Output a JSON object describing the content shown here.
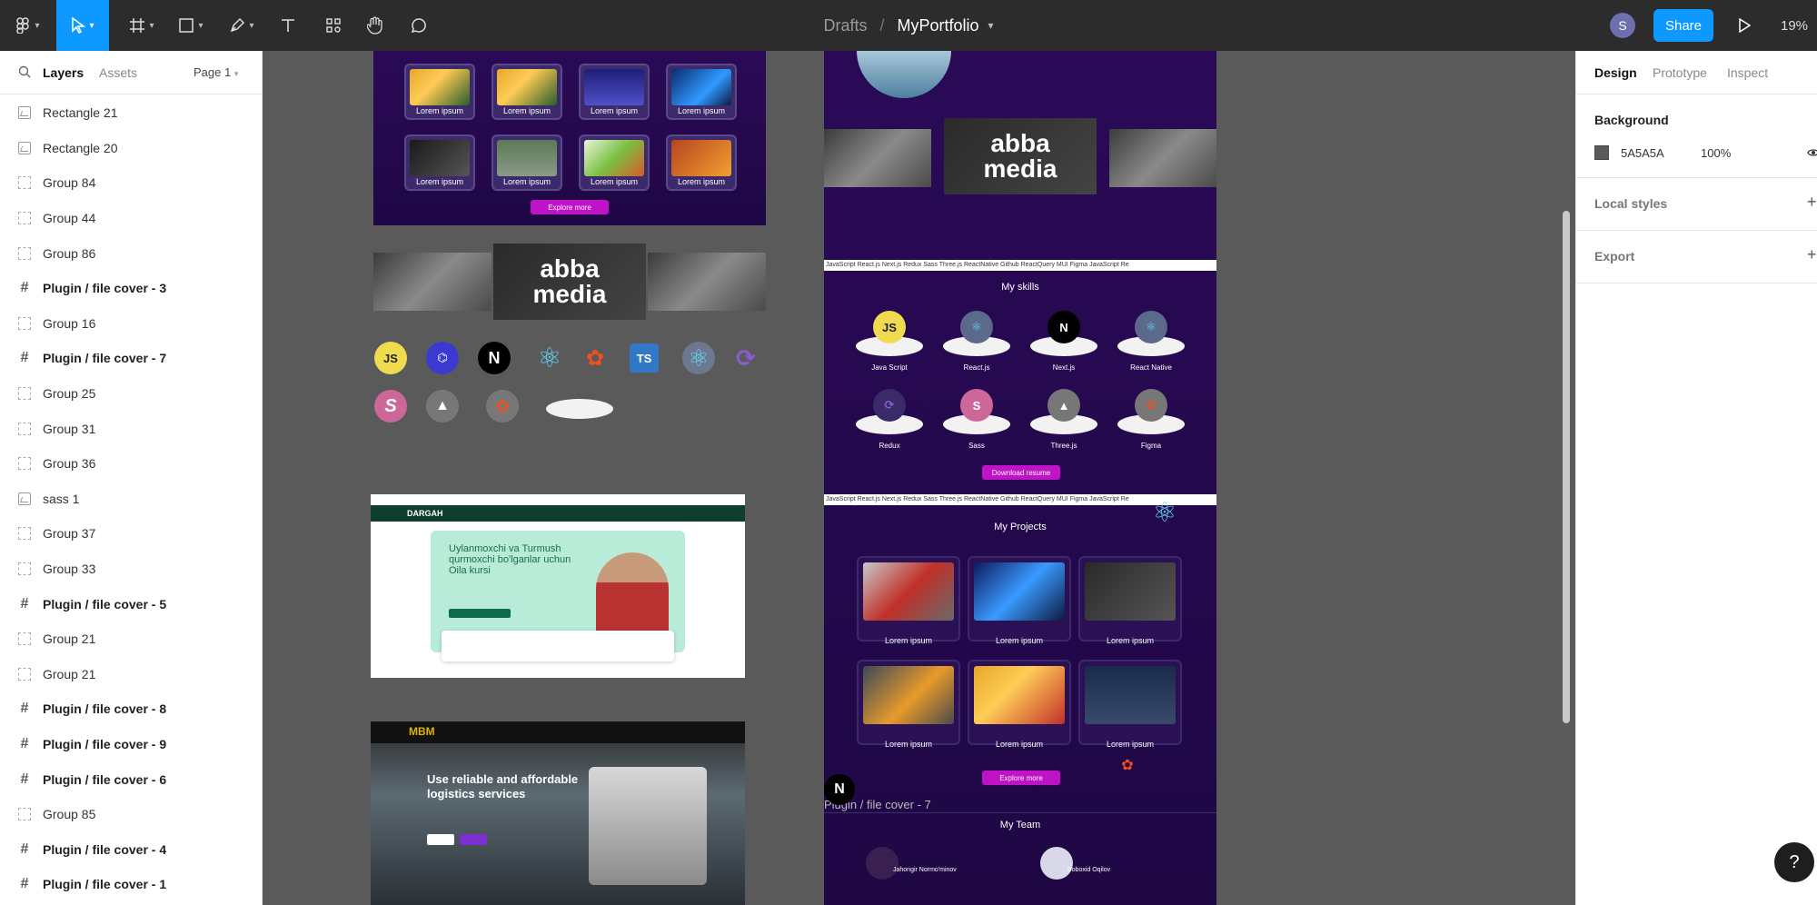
{
  "toolbar": {
    "breadcrumb": "Drafts",
    "separator": "/",
    "file_name": "MyPortfolio",
    "avatar_initial": "S",
    "share_label": "Share",
    "zoom": "19%"
  },
  "left_panel": {
    "tabs": [
      "Layers",
      "Assets"
    ],
    "page_selector": "Page 1",
    "layers": [
      {
        "label": "Rectangle 21",
        "type": "image"
      },
      {
        "label": "Rectangle 20",
        "type": "image"
      },
      {
        "label": "Group 84",
        "type": "group"
      },
      {
        "label": "Group 44",
        "type": "group"
      },
      {
        "label": "Group 86",
        "type": "group"
      },
      {
        "label": "Plugin / file cover - 3",
        "type": "frame"
      },
      {
        "label": "Group 16",
        "type": "group"
      },
      {
        "label": "Plugin / file cover - 7",
        "type": "frame"
      },
      {
        "label": "Group 25",
        "type": "group"
      },
      {
        "label": "Group 31",
        "type": "group"
      },
      {
        "label": "Group 36",
        "type": "group"
      },
      {
        "label": "sass 1",
        "type": "image"
      },
      {
        "label": "Group 37",
        "type": "group"
      },
      {
        "label": "Group 33",
        "type": "group"
      },
      {
        "label": "Plugin / file cover - 5",
        "type": "frame"
      },
      {
        "label": "Group 21",
        "type": "group"
      },
      {
        "label": "Group 21",
        "type": "group"
      },
      {
        "label": "Plugin / file cover - 8",
        "type": "frame"
      },
      {
        "label": "Plugin / file cover - 9",
        "type": "frame"
      },
      {
        "label": "Plugin / file cover - 6",
        "type": "frame"
      },
      {
        "label": "Group 85",
        "type": "group"
      },
      {
        "label": "Plugin / file cover - 4",
        "type": "frame"
      },
      {
        "label": "Plugin / file cover - 1",
        "type": "frame"
      }
    ]
  },
  "canvas": {
    "lorem": "Lorem ipsum",
    "explore_more": "Explore more",
    "abba_line1": "abba",
    "abba_line2": "media",
    "tech_js": "JS",
    "tech_ts": "TS",
    "dargah_logo": "DARGAH",
    "dargah_heading": "Uylanmoxchi va Turmush qurmoxchi bo'lganlar uchun Oila kursi",
    "mbm_logo": "MBM",
    "mbm_heading": "Use reliable and affordable logistics services",
    "marquee": "JavaScript  React.js  Next.js  Redux  Sass  Three.js  ReactNative  Github  ReactQuery  MUI  Figma  JavaScript  Re",
    "skills_title": "My skills",
    "skills": [
      "Java Script",
      "React.js",
      "Next.js",
      "React Native",
      "Redux",
      "Sass",
      "Three.js",
      "Figma"
    ],
    "download_resume": "Download resume",
    "projects_title": "My Projects",
    "frame_label": "Plugin / file cover - 7",
    "team_title": "My Team",
    "team": [
      "Jahongir Normo'minov",
      "Boboxid Oqilov"
    ]
  },
  "right_panel": {
    "tabs": [
      "Design",
      "Prototype",
      "Inspect"
    ],
    "background_label": "Background",
    "bg_hex": "5A5A5A",
    "bg_opacity": "100%",
    "local_styles": "Local styles",
    "export": "Export",
    "bg_color": "#5a5a5a"
  },
  "help": "?"
}
